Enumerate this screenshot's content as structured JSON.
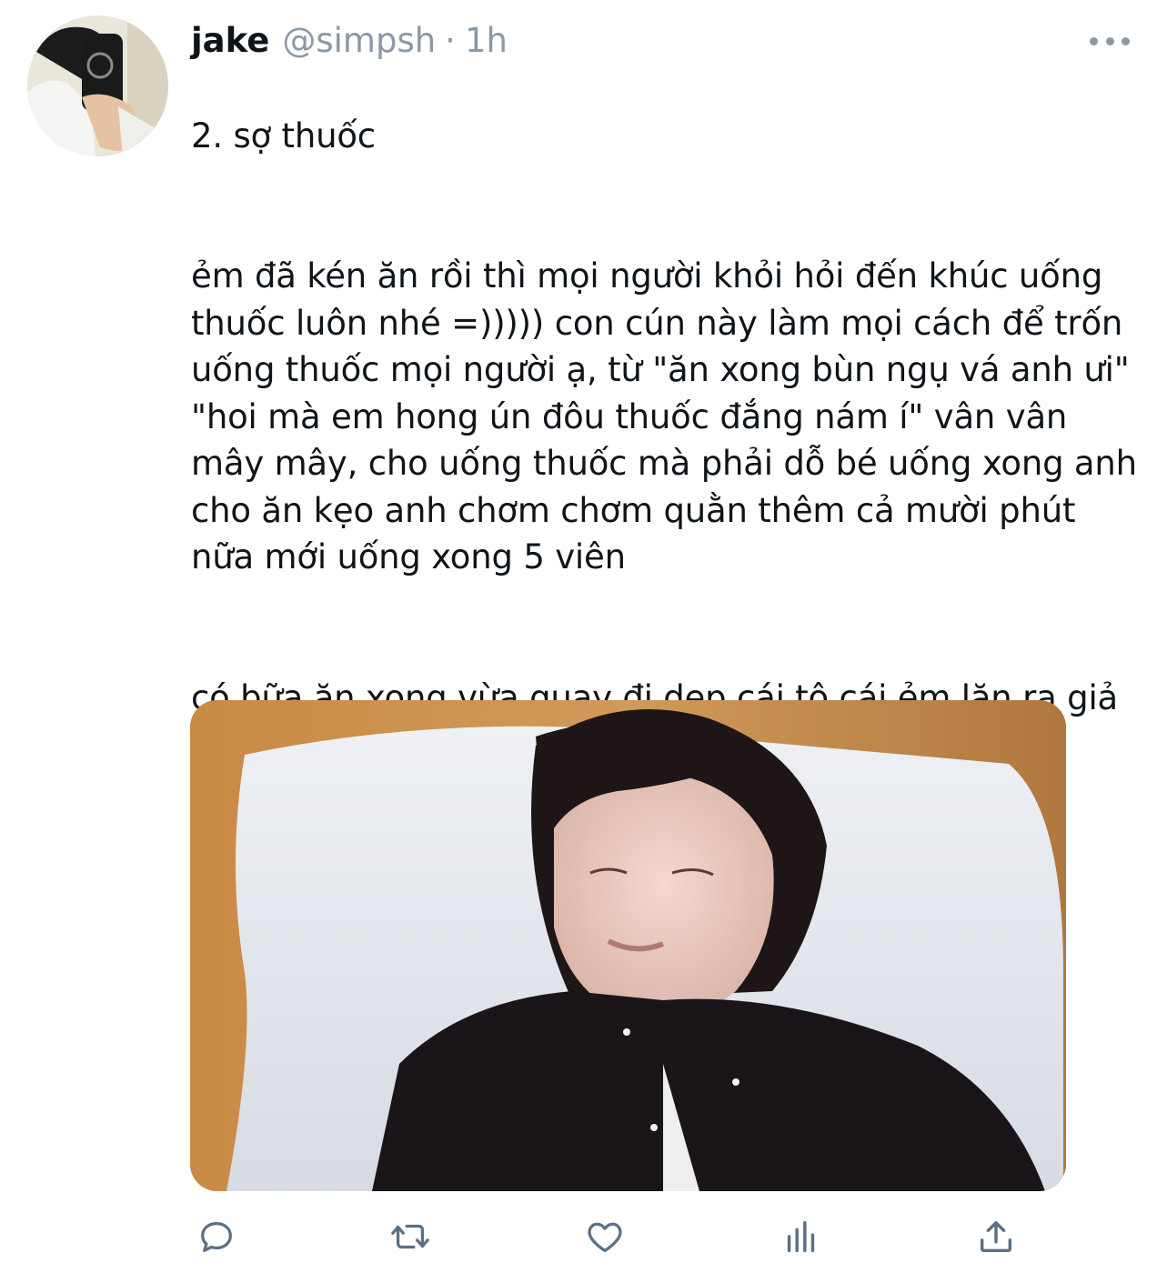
{
  "tweet": {
    "display_name": "jake",
    "handle": "@simpsh",
    "separator": "·",
    "time": "1h",
    "paragraphs": [
      "2. sợ thuốc",
      "ẻm đã kén ăn rồi thì mọi người khỏi hỏi đến khúc uống thuốc luôn nhé =))))) con cún này làm mọi cách để trốn uống thuốc mọi người ạ, từ \"ăn xong bùn ngụ vá anh ưi\" \"hoi mà em hong ún đôu thuốc đắng nám í\" vân vân mây mây, cho uống thuốc mà phải dỗ bé uống xong anh cho ăn kẹo anh chơm chơm quằn thêm cả mười phút nữa mới uống xong 5 viên",
      "có bữa ăn xong vừa quay đi dẹp cái tô cái ẻm lăn ra giả ngủ để trốn thuốc thế này đây =))))))"
    ]
  },
  "icons": {
    "avatar": "avatar-photo",
    "more": "more-dots-icon",
    "reply": "reply-icon",
    "retweet": "retweet-icon",
    "like": "heart-icon",
    "views": "analytics-icon",
    "share": "share-icon"
  },
  "colors": {
    "text": "#0f1419",
    "secondary": "#8b98a5",
    "icon": "#5b7083"
  }
}
